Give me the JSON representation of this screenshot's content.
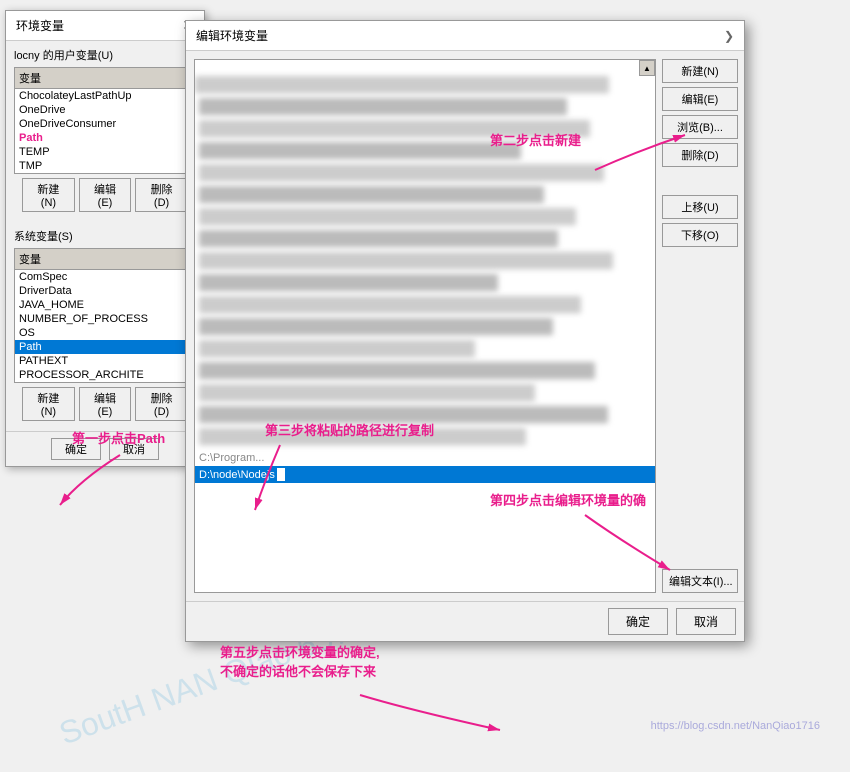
{
  "envDialog": {
    "title": "环境变量",
    "closeBtn": "✕",
    "userSection": {
      "label": "locny 的用户变量(U)",
      "colHeader": "变量",
      "variables": [
        {
          "name": "ChocolateyLastPathUp",
          "selected": false
        },
        {
          "name": "OneDrive",
          "selected": false
        },
        {
          "name": "OneDriveConsumer",
          "selected": false
        },
        {
          "name": "Path",
          "selected": false,
          "highlight": true
        },
        {
          "name": "TEMP",
          "selected": false
        },
        {
          "name": "TMP",
          "selected": false
        }
      ]
    },
    "systemSection": {
      "label": "系统变量(S)",
      "colHeader": "变量",
      "variables": [
        {
          "name": "ComSpec",
          "selected": false
        },
        {
          "name": "DriverData",
          "selected": false
        },
        {
          "name": "JAVA_HOME",
          "selected": false
        },
        {
          "name": "NUMBER_OF_PROCESS",
          "selected": false
        },
        {
          "name": "OS",
          "selected": false
        },
        {
          "name": "Path",
          "selected": true
        },
        {
          "name": "PATHEXT",
          "selected": false
        },
        {
          "name": "PROCESSOR_ARCHITE",
          "selected": false
        }
      ]
    },
    "buttons": {
      "ok": "确定",
      "cancel": "取消"
    }
  },
  "editDialog": {
    "title": "编辑环境变量",
    "maximizeBtn": "❯",
    "pathItems": [
      {
        "value": "blurred1",
        "blur": true
      },
      {
        "value": "blurred2",
        "blur": true
      },
      {
        "value": "blurred3",
        "blur": true
      },
      {
        "value": "blurred4",
        "blur": true
      },
      {
        "value": "blurred5",
        "blur": true
      },
      {
        "value": "blurred6",
        "blur": true
      },
      {
        "value": "blurred7",
        "blur": true
      },
      {
        "value": "blurred8",
        "blur": true
      },
      {
        "value": "blurred9",
        "blur": true
      },
      {
        "value": "blurred10",
        "blur": true
      },
      {
        "value": "blurred11",
        "blur": true
      },
      {
        "value": "blurred12",
        "blur": true
      },
      {
        "value": "blurred13",
        "blur": true
      }
    ],
    "grayRowValue": "C:\\Program...",
    "selectedRowValue": "D:\\node\\Nodejs",
    "sidebar": {
      "newBtn": "新建(N)",
      "editBtn": "编辑(E)",
      "browseBtn": "浏览(B)...",
      "deleteBtn": "删除(D)",
      "moveUpBtn": "上移(U)",
      "moveDownBtn": "下移(O)",
      "editTextBtn": "编辑文本(I)..."
    },
    "footer": {
      "okBtn": "确定",
      "cancelBtn": "取消"
    }
  },
  "annotations": {
    "step1": "第一步点击Path",
    "step2": "第二步点击新建",
    "step3": "第三步将粘贴的路径进行复制",
    "step4": "第四步点击编辑环境量的确",
    "step5line1": "第五步点击环境变量的确定,",
    "step5line2": "不确定的话他不会保存下来"
  }
}
